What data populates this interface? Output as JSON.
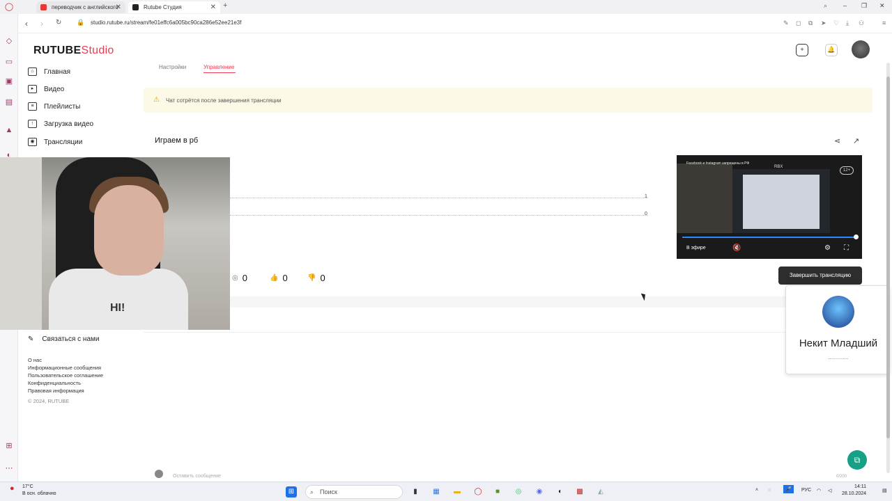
{
  "browser": {
    "tabs": [
      {
        "title": "переводчик с английского",
        "active": false
      },
      {
        "title": "Rutube Студия",
        "active": true
      }
    ],
    "url": "studio.rutube.ru/stream/fe01effc6a005bc90ca286e52ee21e3f"
  },
  "header": {
    "logo_rutube": "RUTUBE",
    "logo_studio": "Studio"
  },
  "sidebar": {
    "items": [
      {
        "label": "Главная",
        "icon": "home-icon"
      },
      {
        "label": "Видео",
        "icon": "video-icon"
      },
      {
        "label": "Плейлисты",
        "icon": "playlist-icon"
      },
      {
        "label": "Загрузка видео",
        "icon": "upload-icon"
      },
      {
        "label": "Трансляции",
        "icon": "broadcast-icon"
      }
    ],
    "contact": "Связаться с нами",
    "footer_links": [
      "О нас",
      "Информационные сообщения",
      "Пользовательское соглашение",
      "Конфиденциальность",
      "Правовая информация"
    ],
    "copyright": "© 2024, RUTUBE"
  },
  "content": {
    "tabs": [
      "Настройки",
      "Управление"
    ],
    "warning": "Чат сотрётся после завершения трансляции",
    "stream_title": "Играем в рб",
    "chart_ticks": [
      "1",
      "0"
    ],
    "stats": {
      "viewers": "0",
      "likes": "0",
      "dislikes": "0"
    },
    "end_button": "Завершить трансляцию",
    "chat_placeholder": "Оставить сообщение",
    "chat_counter": "0/200"
  },
  "player": {
    "title": "Facebook и Instagram запрещены в РФ",
    "rbx_label": "RBX",
    "age": "12+",
    "live_label": "В эфире"
  },
  "webcam": {
    "shirt_text": "HI!"
  },
  "notification": {
    "name": "Некит Младший",
    "subtitle": "..............."
  },
  "taskbar": {
    "temperature": "17°C",
    "weather": "В осн. облачно",
    "search": "Поиск",
    "lang": "РУС",
    "time": "14:11",
    "date": "28.10.2024"
  }
}
